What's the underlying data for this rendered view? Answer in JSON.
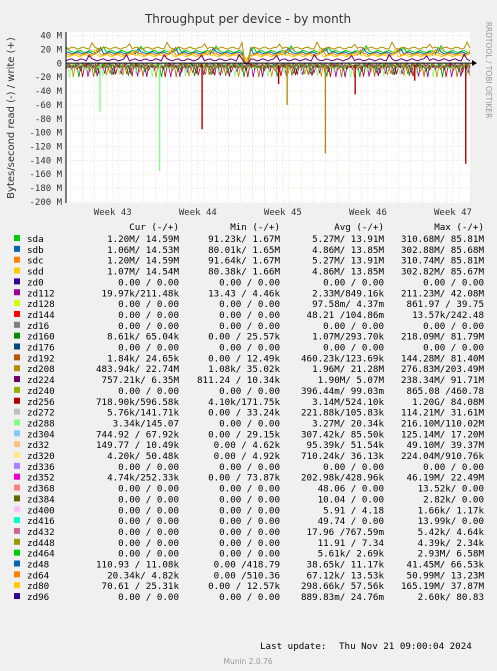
{
  "chart_data": {
    "type": "line",
    "title": "Throughput per device - by month",
    "ylabel": "Bytes/second read (-) / write (+)",
    "ylim": [
      -200,
      40
    ],
    "yticks": [
      "40 M",
      "20 M",
      "0",
      "-20 M",
      "-40 M",
      "-60 M",
      "-80 M",
      "-100 M",
      "-120 M",
      "-140 M",
      "-160 M",
      "-180 M",
      "-200 M"
    ],
    "ytick_values": [
      40,
      20,
      0,
      -20,
      -40,
      -60,
      -80,
      -100,
      -120,
      -140,
      -160,
      -180,
      -200
    ],
    "xticks": [
      "Week 43",
      "Week 44",
      "Week 45",
      "Week 46",
      "Week 47"
    ],
    "side_label": "RRDTOOL / TOBI OETIKER",
    "columns": [
      "Cur (-/+)",
      "Min (-/+)",
      "Avg (-/+)",
      "Max (-/+)"
    ],
    "grid": true,
    "series": [
      {
        "name": "sda",
        "color": "#00cc00",
        "cur": "1.20M/ 14.59M",
        "min": "91.23k/  1.67M",
        "avg": "5.27M/ 13.91M",
        "max": "310.68M/ 85.81M"
      },
      {
        "name": "sdb",
        "color": "#0066b3",
        "cur": "1.06M/ 14.53M",
        "min": "80.01k/  1.65M",
        "avg": "4.86M/ 13.85M",
        "max": "302.88M/ 85.68M"
      },
      {
        "name": "sdc",
        "color": "#ff8000",
        "cur": "1.20M/ 14.59M",
        "min": "91.64k/  1.67M",
        "avg": "5.27M/ 13.91M",
        "max": "310.74M/ 85.81M"
      },
      {
        "name": "sdd",
        "color": "#ffcc00",
        "cur": "1.07M/ 14.54M",
        "min": "80.38k/  1.66M",
        "avg": "4.86M/ 13.85M",
        "max": "302.82M/ 85.67M"
      },
      {
        "name": "zd0",
        "color": "#330099",
        "cur": "0.00 /  0.00",
        "min": "0.00 /  0.00",
        "avg": "0.00 /  0.00",
        "max": "0.00 /  0.00"
      },
      {
        "name": "zd112",
        "color": "#990099",
        "cur": "19.97k/211.48k",
        "min": "13.43 /  4.46k",
        "avg": "2.33M/849.16k",
        "max": "211.23M/ 42.08M"
      },
      {
        "name": "zd128",
        "color": "#ccff00",
        "cur": "0.00 /  0.00",
        "min": "0.00 /  0.00",
        "avg": "97.58m/  4.37m",
        "max": "861.97 / 39.75"
      },
      {
        "name": "zd144",
        "color": "#ff0000",
        "cur": "0.00 /  0.00",
        "min": "0.00 /  0.00",
        "avg": "48.21 /104.86m",
        "max": "13.57k/242.48"
      },
      {
        "name": "zd16",
        "color": "#808080",
        "cur": "0.00 /  0.00",
        "min": "0.00 /  0.00",
        "avg": "0.00 /  0.00",
        "max": "0.00 /  0.00"
      },
      {
        "name": "zd160",
        "color": "#008f00",
        "cur": "8.61k/ 65.04k",
        "min": "0.00 / 25.57k",
        "avg": "1.07M/293.70k",
        "max": "218.09M/ 81.79M"
      },
      {
        "name": "zd176",
        "color": "#00487d",
        "cur": "0.00 /  0.00",
        "min": "0.00 /  0.00",
        "avg": "0.00 /  0.00",
        "max": "0.00 /  0.00"
      },
      {
        "name": "zd192",
        "color": "#b35a00",
        "cur": "1.84k/ 24.65k",
        "min": "0.00 / 12.49k",
        "avg": "460.23k/123.69k",
        "max": "144.28M/ 81.40M"
      },
      {
        "name": "zd208",
        "color": "#b38f00",
        "cur": "483.94k/ 22.74M",
        "min": "1.08k/ 35.02k",
        "avg": "1.96M/ 21.28M",
        "max": "276.83M/203.49M"
      },
      {
        "name": "zd224",
        "color": "#6b006b",
        "cur": "757.21k/  6.35M",
        "min": "811.24 / 10.34k",
        "avg": "1.90M/  5.07M",
        "max": "238.34M/ 91.71M"
      },
      {
        "name": "zd240",
        "color": "#8fb300",
        "cur": "0.00 /  0.00",
        "min": "0.00 /  0.00",
        "avg": "396.44m/ 99.03m",
        "max": "865.08 /460.78"
      },
      {
        "name": "zd256",
        "color": "#b30000",
        "cur": "718.90k/596.58k",
        "min": "4.10k/171.75k",
        "avg": "3.14M/524.10k",
        "max": "1.20G/ 84.08M"
      },
      {
        "name": "zd272",
        "color": "#bebebe",
        "cur": "5.76k/141.71k",
        "min": "0.00 / 33.24k",
        "avg": "221.88k/105.83k",
        "max": "114.21M/ 31.61M"
      },
      {
        "name": "zd288",
        "color": "#80ff80",
        "cur": "3.34k/145.07",
        "min": "0.00 /  0.00",
        "avg": "3.27M/ 20.34k",
        "max": "216.10M/110.02M"
      },
      {
        "name": "zd304",
        "color": "#80c9ff",
        "cur": "744.92 / 67.92k",
        "min": "0.00 / 29.15k",
        "avg": "307.42k/ 85.50k",
        "max": "125.14M/ 17.20M"
      },
      {
        "name": "zd32",
        "color": "#ffc080",
        "cur": "149.77 / 10.49k",
        "min": "0.00 /  4.62k",
        "avg": "95.39k/ 51.54k",
        "max": "49.10M/ 39.37M"
      },
      {
        "name": "zd320",
        "color": "#ffe680",
        "cur": "4.20k/ 50.48k",
        "min": "0.00 /  4.92k",
        "avg": "710.24k/ 36.13k",
        "max": "224.04M/910.76k"
      },
      {
        "name": "zd336",
        "color": "#aa80ff",
        "cur": "0.00 /  0.00",
        "min": "0.00 /  0.00",
        "avg": "0.00 /  0.00",
        "max": "0.00 /  0.00"
      },
      {
        "name": "zd352",
        "color": "#ee00cc",
        "cur": "4.74k/252.33k",
        "min": "0.00 / 73.87k",
        "avg": "202.98k/428.96k",
        "max": "46.19M/ 22.49M"
      },
      {
        "name": "zd368",
        "color": "#ff8080",
        "cur": "0.00 /  0.00",
        "min": "0.00 /  0.00",
        "avg": "48.06 /  0.00",
        "max": "13.52k/  0.00"
      },
      {
        "name": "zd384",
        "color": "#666600",
        "cur": "0.00 /  0.00",
        "min": "0.00 /  0.00",
        "avg": "10.04 /  0.00",
        "max": "2.82k/  0.00"
      },
      {
        "name": "zd400",
        "color": "#ffbfff",
        "cur": "0.00 /  0.00",
        "min": "0.00 /  0.00",
        "avg": "5.91 /  4.18",
        "max": "1.66k/  1.17k"
      },
      {
        "name": "zd416",
        "color": "#00ffcc",
        "cur": "0.00 /  0.00",
        "min": "0.00 /  0.00",
        "avg": "49.74 /  0.00",
        "max": "13.99k/  0.00"
      },
      {
        "name": "zd432",
        "color": "#cc6699",
        "cur": "0.00 /  0.00",
        "min": "0.00 /  0.00",
        "avg": "17.96 /767.59m",
        "max": "5.42k/  4.64k"
      },
      {
        "name": "zd448",
        "color": "#999900",
        "cur": "0.00 /  0.00",
        "min": "0.00 /  0.00",
        "avg": "11.91 /  7.34",
        "max": "4.39k/  2.34k"
      },
      {
        "name": "zd464",
        "color": "#00cc00",
        "cur": "0.00 /  0.00",
        "min": "0.00 /  0.00",
        "avg": "5.61k/  2.69k",
        "max": "2.93M/  6.58M"
      },
      {
        "name": "zd48",
        "color": "#0066b3",
        "cur": "110.93 / 11.08k",
        "min": "0.00 /418.79",
        "avg": "38.65k/ 11.17k",
        "max": "41.45M/ 66.53k"
      },
      {
        "name": "zd64",
        "color": "#ff8000",
        "cur": "20.34k/  4.82k",
        "min": "0.00 /510.36",
        "avg": "67.12k/ 13.53k",
        "max": "50.99M/ 13.23M"
      },
      {
        "name": "zd80",
        "color": "#ffcc00",
        "cur": "70.61 / 25.31k",
        "min": "0.00 / 12.57k",
        "avg": "298.66k/ 57.56k",
        "max": "165.19M/ 37.87M"
      },
      {
        "name": "zd96",
        "color": "#330099",
        "cur": "0.00 /  0.00",
        "min": "0.00 /  0.00",
        "avg": "889.83m/ 24.76m",
        "max": "2.60k/ 80.83"
      }
    ],
    "write_traces": [
      {
        "name": "sda",
        "level": 17
      },
      {
        "name": "sdb",
        "level": 15
      },
      {
        "name": "sdc",
        "level": 13
      },
      {
        "name": "sdd",
        "level": 11
      },
      {
        "name": "zd208",
        "level": 22
      },
      {
        "name": "zd224",
        "level": 5
      }
    ],
    "read_spikes": [
      {
        "name": "zd288",
        "week": 42.85,
        "value": -70
      },
      {
        "name": "zd288",
        "week": 43.55,
        "value": -155
      },
      {
        "name": "zd256",
        "week": 44.05,
        "value": -95
      },
      {
        "name": "zd256",
        "week": 44.95,
        "value": -30
      },
      {
        "name": "zd208",
        "week": 45.05,
        "value": -60
      },
      {
        "name": "zd208",
        "week": 45.5,
        "value": -130
      },
      {
        "name": "zd256",
        "week": 45.85,
        "value": -45
      },
      {
        "name": "zd256",
        "week": 46.55,
        "value": -25
      },
      {
        "name": "zd256",
        "week": 47.15,
        "value": -145
      }
    ],
    "x_range": [
      42.45,
      47.2
    ]
  },
  "footer": {
    "update_label": "Last update:",
    "update_value": "Thu Nov 21 09:00:04 2024",
    "munin_version": "Munin 2.0.76"
  }
}
